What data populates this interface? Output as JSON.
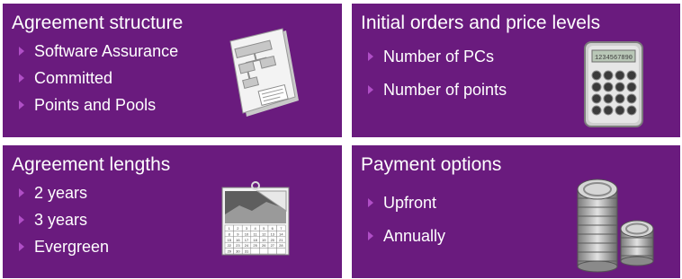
{
  "panels": [
    {
      "title": "Agreement structure",
      "items": [
        "Software Assurance",
        "Committed",
        "Points and Pools"
      ],
      "icon": "document-diagram-icon"
    },
    {
      "title": "Initial orders and price levels",
      "items": [
        "Number of PCs",
        "Number of points"
      ],
      "icon": "calculator-icon",
      "calculator_display": "1234567890"
    },
    {
      "title": "Agreement lengths",
      "items": [
        "2 years",
        "3 years",
        "Evergreen"
      ],
      "icon": "calendar-icon",
      "calendar_days": [
        "1",
        "2",
        "3",
        "4",
        "5",
        "6",
        "7",
        "8",
        "9",
        "10",
        "11",
        "12",
        "13",
        "14",
        "15",
        "16",
        "17",
        "18",
        "19",
        "20",
        "21",
        "22",
        "23",
        "24",
        "25",
        "26",
        "27",
        "28",
        "29",
        "30",
        "31"
      ]
    },
    {
      "title": "Payment options",
      "items": [
        "Upfront",
        "Annually"
      ],
      "icon": "coin-stacks-icon"
    }
  ],
  "colors": {
    "panel_bg": "#6a1b7e",
    "bullet": "#b04fc6",
    "text": "#ffffff"
  }
}
